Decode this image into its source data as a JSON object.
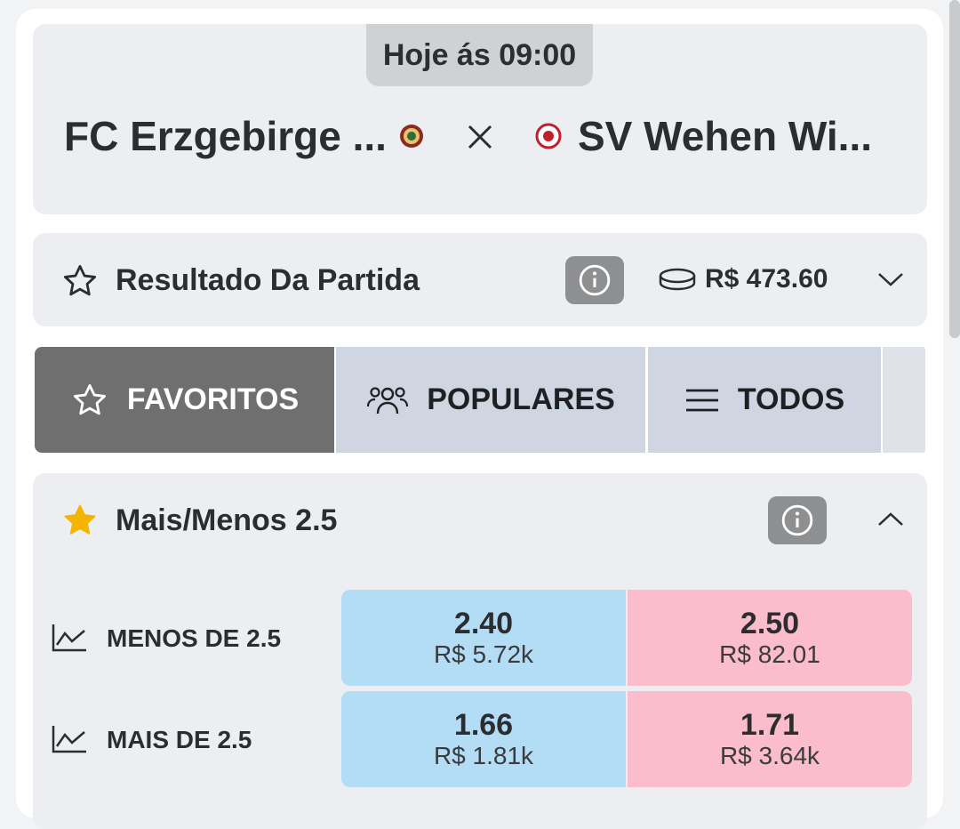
{
  "match": {
    "time": "Hoje ás 09:00",
    "home_team": "FC Erzgebirge ...",
    "away_team": "SV Wehen Wi...",
    "home_crest_color": "#8b2a23",
    "away_crest_color": "#c0202e"
  },
  "market": {
    "title": "Resultado Da Partida",
    "stake": "R$ 473.60",
    "icons": [
      "star-outline-icon",
      "info-icon",
      "coins-icon",
      "chevron-down-icon"
    ]
  },
  "tabs": [
    {
      "label": "FAVORITOS",
      "icon": "star-outline-icon",
      "active": true
    },
    {
      "label": "POPULARES",
      "icon": "users-icon",
      "active": false
    },
    {
      "label": "TODOS",
      "icon": "menu-icon",
      "active": false
    }
  ],
  "over_under": {
    "title": "Mais/Menos 2.5",
    "rows": [
      {
        "label": "MENOS DE 2.5",
        "back_price": "2.40",
        "back_volume": "R$ 5.72k",
        "lay_price": "2.50",
        "lay_volume": "R$ 82.01"
      },
      {
        "label": "MAIS DE 2.5",
        "back_price": "1.66",
        "back_volume": "R$ 1.81k",
        "lay_price": "1.71",
        "lay_volume": "R$ 3.64k"
      }
    ]
  },
  "colors": {
    "back": "#b3dcf5",
    "lay": "#fbbccb",
    "active_tab": "#6f6f70",
    "favorite_star": "#f5b400"
  }
}
